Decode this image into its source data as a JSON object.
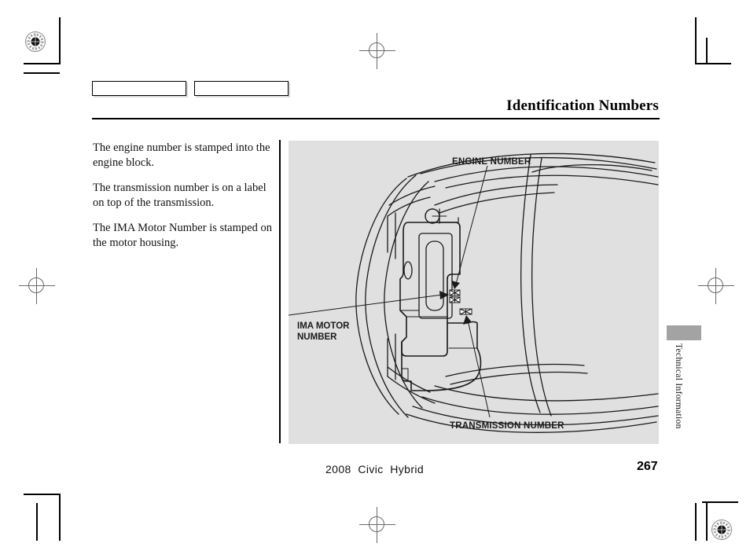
{
  "document": {
    "title": "Identification Numbers",
    "footer_model": "2008  Civic  Hybrid",
    "page_number": "267",
    "thumb_tab_label": "Technical Information"
  },
  "header": {
    "tabs": [
      {
        "label": ""
      },
      {
        "label": ""
      }
    ]
  },
  "body": {
    "paragraphs": [
      "The engine number is stamped into the engine block.",
      "The transmission number is on a label on top of the transmission.",
      "The IMA Motor Number is stamped on the motor housing."
    ]
  },
  "figure": {
    "callouts": [
      {
        "id": "engine",
        "label": "ENGINE NUMBER"
      },
      {
        "id": "ima",
        "label": "IMA MOTOR\nNUMBER"
      },
      {
        "id": "transmission",
        "label": "TRANSMISSION NUMBER"
      }
    ],
    "background_color": "#e0e0e0",
    "line_color": "#1a1a1a"
  },
  "print_marks": {
    "registration_targets": 2,
    "registration_crosses": 3,
    "accent_color": "#6a6a6a"
  }
}
